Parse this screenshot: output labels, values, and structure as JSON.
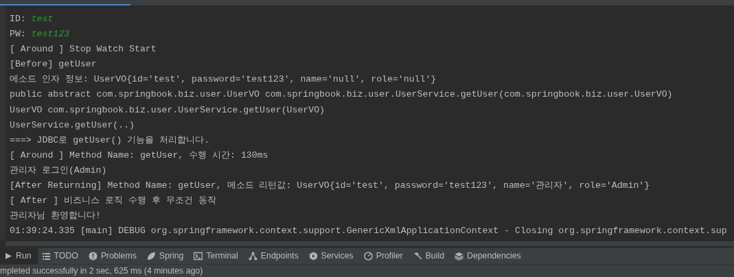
{
  "console": {
    "lines": [
      {
        "kind": "field",
        "label": "ID: ",
        "value": "test"
      },
      {
        "kind": "field",
        "label": "PW: ",
        "value": "test123"
      },
      {
        "kind": "plain",
        "text": "[ Around ] Stop Watch Start"
      },
      {
        "kind": "plain",
        "text": "[Before] getUser"
      },
      {
        "kind": "plain",
        "text": "메소드 인자 정보: UserVO{id='test', password='test123', name='null', role='null'}"
      },
      {
        "kind": "plain",
        "text": "public abstract com.springbook.biz.user.UserVO com.springbook.biz.user.UserService.getUser(com.springbook.biz.user.UserVO)"
      },
      {
        "kind": "plain",
        "text": "UserVO com.springbook.biz.user.UserService.getUser(UserVO)"
      },
      {
        "kind": "plain",
        "text": "UserService.getUser(..)"
      },
      {
        "kind": "plain",
        "text": "===> JDBC로 getUser() 기능을 처리합니다."
      },
      {
        "kind": "plain",
        "text": "[ Around ] Method Name: getUser, 수행 시간: 130ms"
      },
      {
        "kind": "plain",
        "text": "관리자 로그인(Admin)"
      },
      {
        "kind": "plain",
        "text": "[After Returning] Method Name: getUser, 메소드 리턴값: UserVO{id='test', password='test123', name='관리자', role='Admin'}"
      },
      {
        "kind": "plain",
        "text": "[ After ] 비즈니스 로직 수행 후 무조건 동작"
      },
      {
        "kind": "plain",
        "text": "관리자님 환영합니다!"
      },
      {
        "kind": "plain",
        "text": "01:39:24.335 [main] DEBUG org.springframework.context.support.GenericXmlApplicationContext - Closing org.springframework.context.sup"
      }
    ]
  },
  "tool_tabs": [
    {
      "label": "Run",
      "selected": true
    },
    {
      "label": "TODO",
      "selected": false
    },
    {
      "label": "Problems",
      "selected": false
    },
    {
      "label": "Spring",
      "selected": false
    },
    {
      "label": "Terminal",
      "selected": false
    },
    {
      "label": "Endpoints",
      "selected": false
    },
    {
      "label": "Services",
      "selected": false
    },
    {
      "label": "Profiler",
      "selected": false
    },
    {
      "label": "Build",
      "selected": false
    },
    {
      "label": "Dependencies",
      "selected": false
    }
  ],
  "status_bar": {
    "text": "mpleted successfully in 2 sec, 625 ms (4 minutes ago)"
  }
}
